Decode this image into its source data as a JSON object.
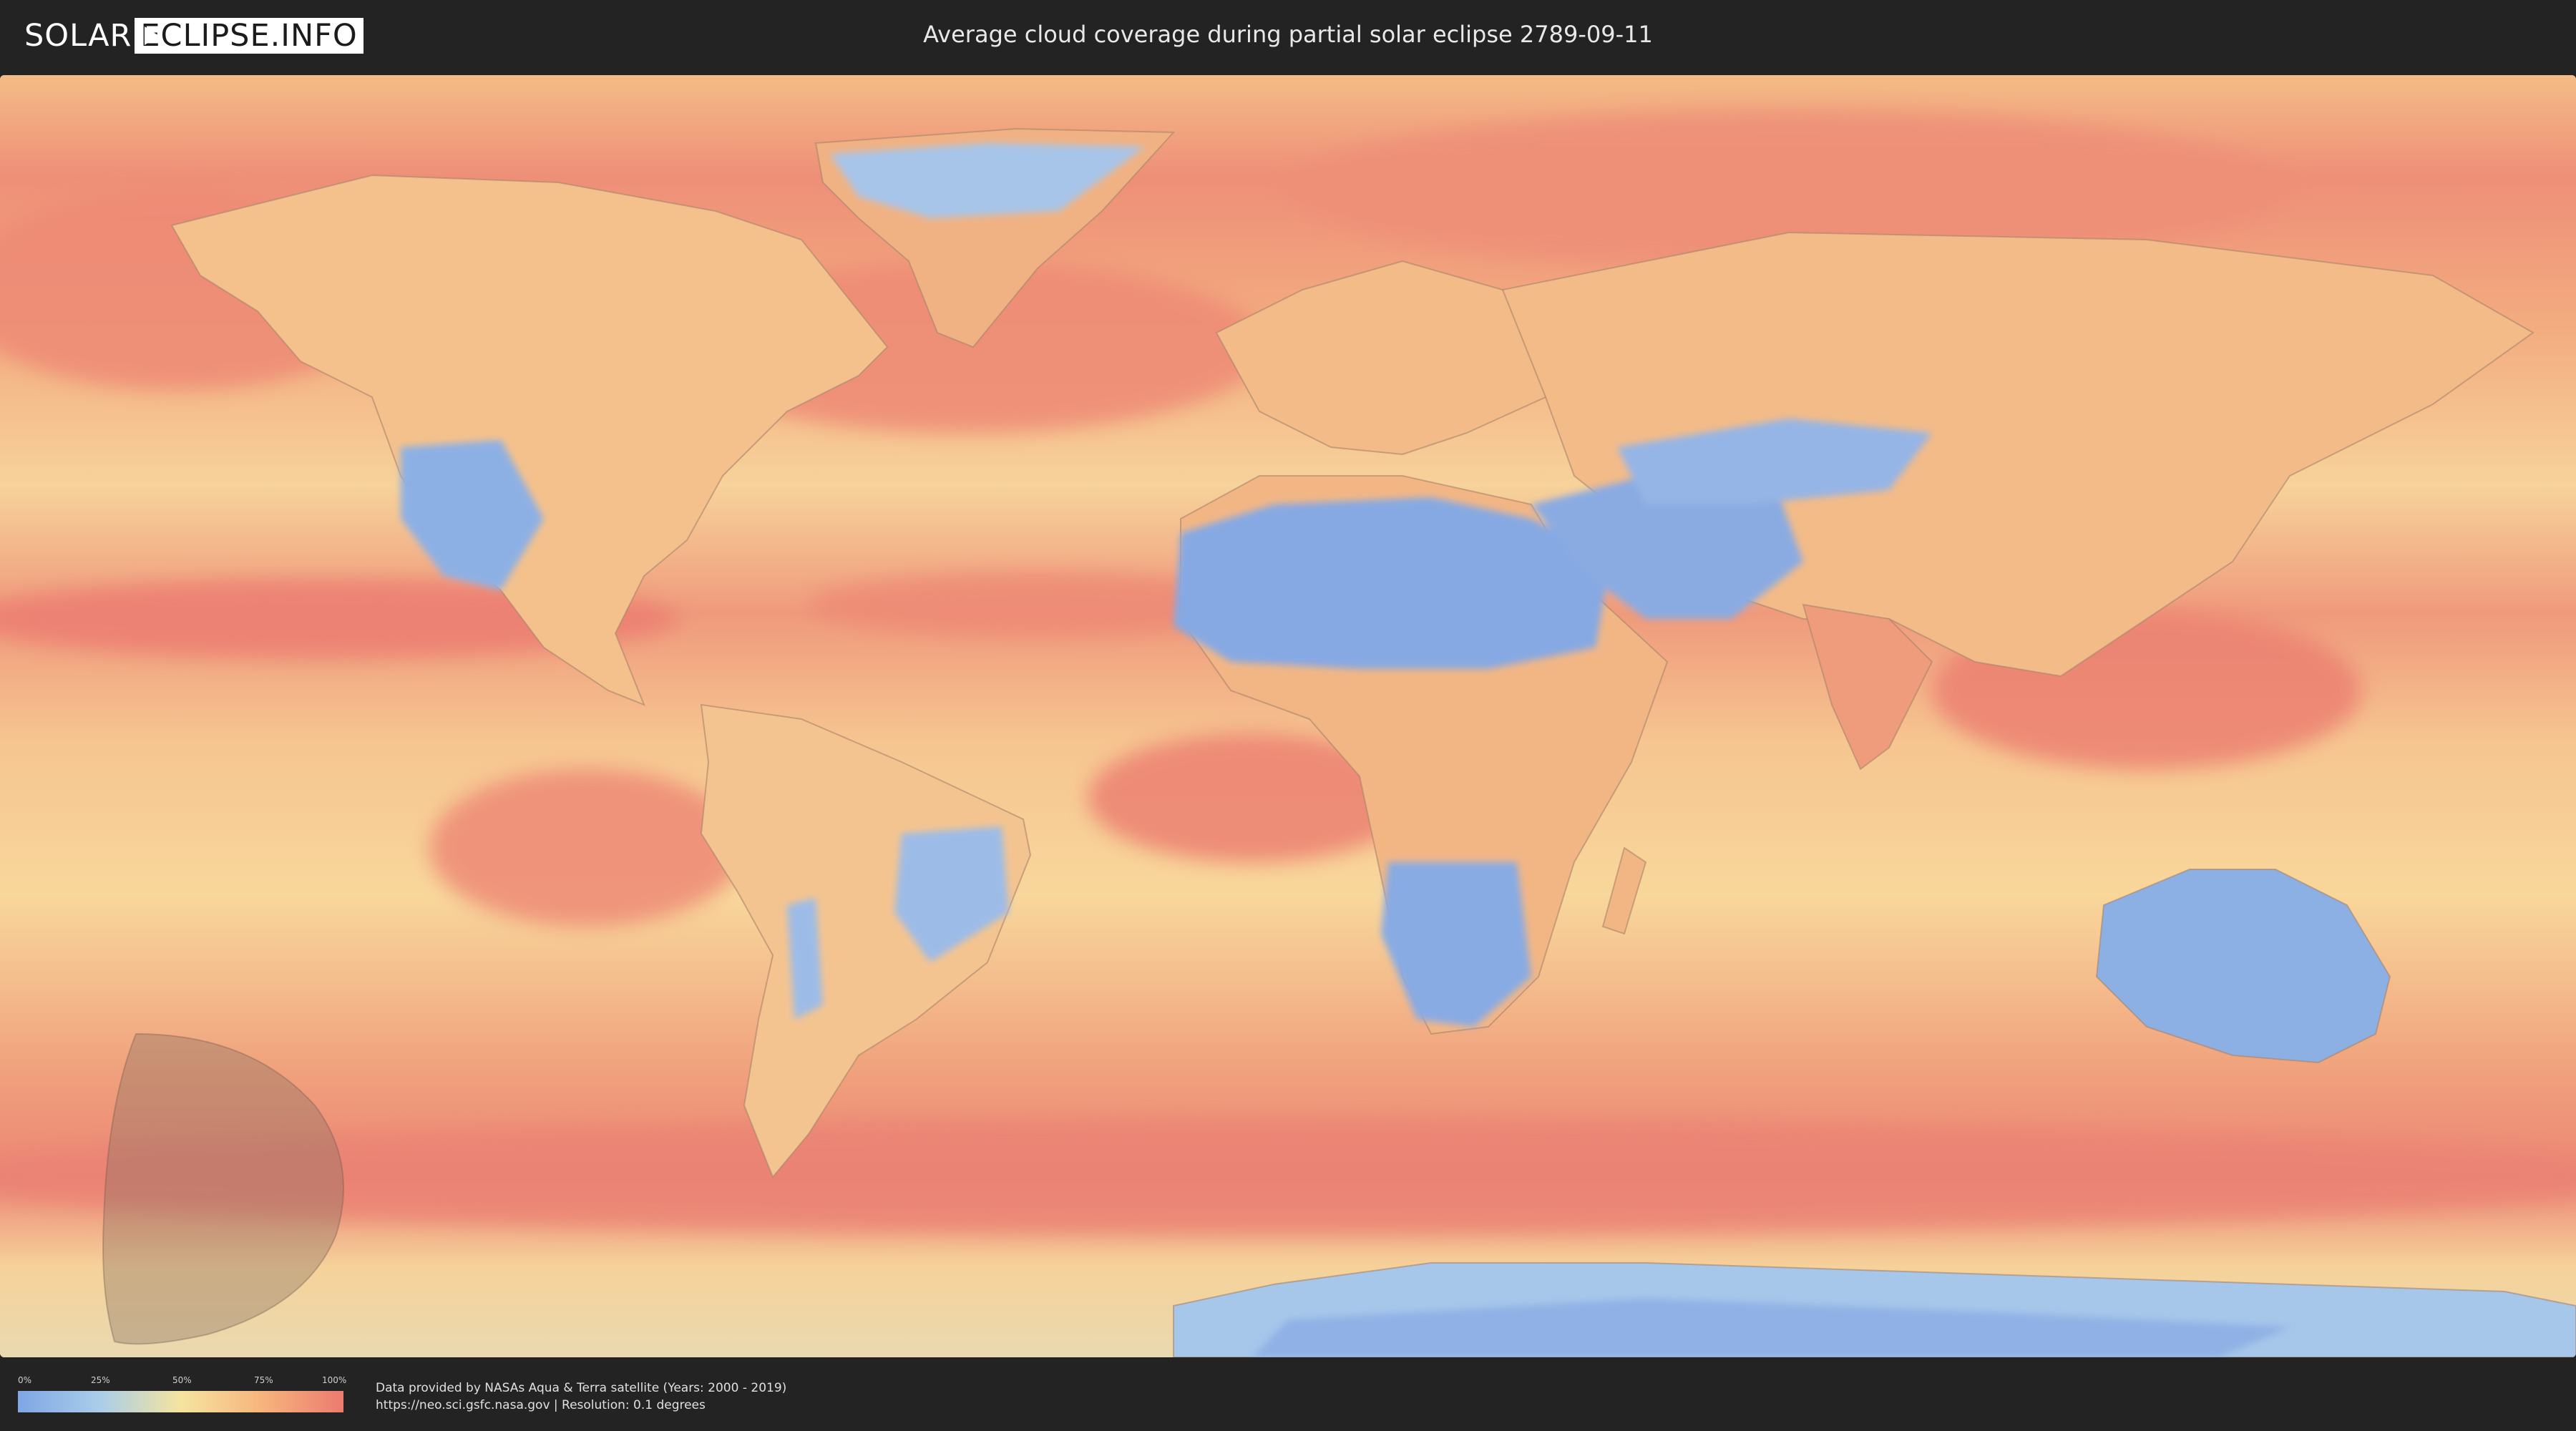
{
  "header": {
    "logo_left": "SOLAR",
    "logo_right": "ECLIPSE.INFO",
    "title": "Average cloud coverage during partial solar eclipse 2789-09-11"
  },
  "map": {
    "colors": {
      "clear": "#7fa6e6",
      "light": "#a9cde9",
      "mid": "#f5e4a0",
      "heavy": "#f7b47c",
      "overcast": "#ec7b70",
      "shadow": "#8a7060"
    }
  },
  "legend": {
    "ticks": [
      "0%",
      "25%",
      "50%",
      "75%",
      "100%"
    ]
  },
  "footer": {
    "credit_line1": "Data provided by NASAs Aqua & Terra satellite (Years: 2000 - 2019)",
    "credit_line2": "https://neo.sci.gsfc.nasa.gov | Resolution: 0.1 degrees"
  }
}
